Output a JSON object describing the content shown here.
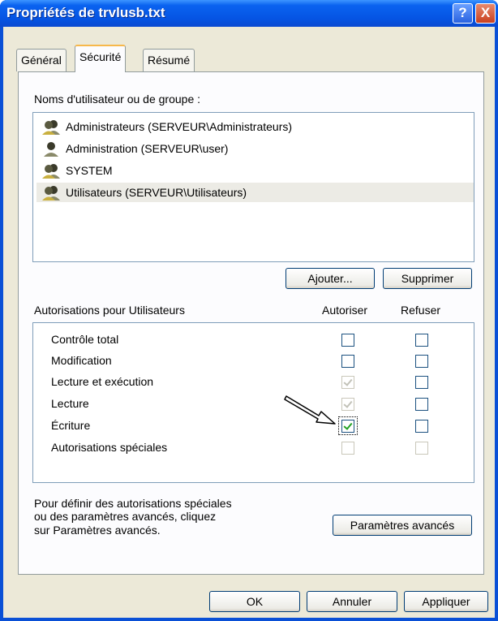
{
  "window": {
    "title": "Propriétés de trvlusb.txt",
    "help_label": "?",
    "close_label": "X"
  },
  "tabs": [
    {
      "label": "Général"
    },
    {
      "label": "Sécurité",
      "active": true
    },
    {
      "label": "Résumé"
    }
  ],
  "users": {
    "label": "Noms d'utilisateur ou de groupe :",
    "items": [
      {
        "label": "Administrateurs (SERVEUR\\Administrateurs)",
        "icon": "group-users-icon"
      },
      {
        "label": "Administration (SERVEUR\\user)",
        "icon": "user-icon"
      },
      {
        "label": "SYSTEM",
        "icon": "group-users-icon"
      },
      {
        "label": "Utilisateurs (SERVEUR\\Utilisateurs)",
        "icon": "group-users-icon",
        "selected": true
      }
    ],
    "add_button": "Ajouter...",
    "remove_button": "Supprimer"
  },
  "permissions": {
    "header": "Autorisations pour Utilisateurs",
    "allow_header": "Autoriser",
    "deny_header": "Refuser",
    "rows": [
      {
        "label": "Contrôle total",
        "allow": "unchecked",
        "deny": "unchecked"
      },
      {
        "label": "Modification",
        "allow": "unchecked",
        "deny": "unchecked"
      },
      {
        "label": "Lecture et exécution",
        "allow": "disabled-checked",
        "deny": "unchecked"
      },
      {
        "label": "Lecture",
        "allow": "disabled-checked",
        "deny": "unchecked"
      },
      {
        "label": "Écriture",
        "allow": "checked",
        "deny": "unchecked"
      },
      {
        "label": "Autorisations spéciales",
        "allow": "disabled",
        "deny": "disabled"
      }
    ]
  },
  "advanced": {
    "text_lines": [
      "Pour définir des autorisations spéciales",
      "ou des paramètres avancés, cliquez",
      "sur Paramètres avancés."
    ],
    "button": "Paramètres avancés"
  },
  "footer": {
    "ok": "OK",
    "cancel": "Annuler",
    "apply": "Appliquer"
  },
  "colors": {
    "titlebar": "#0554e3",
    "dialog_bg": "#ece9d8",
    "checkmark": "#21a121"
  }
}
